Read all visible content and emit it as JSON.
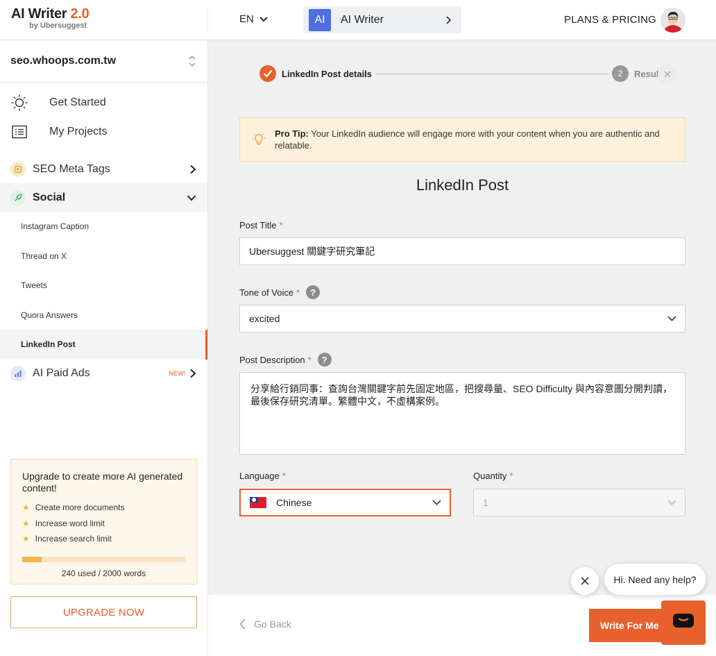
{
  "header": {
    "logo_main": "AI Writer",
    "logo_version": "2.0",
    "logo_sub": "by Ubersuggest",
    "language": "EN",
    "tool_badge": "AI",
    "tool_name": "AI Writer",
    "plans": "PLANS & PRICING"
  },
  "sidebar": {
    "site": "seo.whoops.com.tw",
    "nav": [
      {
        "label": "Get Started",
        "icon": "sun-icon"
      },
      {
        "label": "My Projects",
        "icon": "list-icon"
      }
    ],
    "groups": {
      "seo_meta": {
        "label": "SEO Meta Tags"
      },
      "social": {
        "label": "Social"
      },
      "paid_ads": {
        "label": "AI Paid Ads",
        "badge": "NEW!"
      }
    },
    "social_items": [
      "Instagram Caption",
      "Thread on X",
      "Tweets",
      "Quora Answers",
      "LinkedIn Post"
    ],
    "upgrade": {
      "title": "Upgrade to create more AI generated content!",
      "benefits": [
        "Create more documents",
        "Increase word limit",
        "Increase search limit"
      ],
      "usage_fraction": 0.12,
      "usage_text": "240 used / 2000 words",
      "button": "UPGRADE NOW"
    }
  },
  "stepper": {
    "step1": "LinkedIn Post details",
    "step2_num": "2",
    "step2": "Results"
  },
  "tip": {
    "label": "Pro Tip:",
    "text": " Your LinkedIn audience will engage more with your content when you are authentic and relatable."
  },
  "form": {
    "title": "LinkedIn Post",
    "post_title_label": "Post Title",
    "post_title_value": "Ubersuggest 關鍵字研究筆記",
    "tone_label": "Tone of Voice",
    "tone_value": "excited",
    "desc_label": "Post Description",
    "desc_value": "分享給行銷同事：查詢台灣關鍵字前先固定地區，把搜尋量、SEO Difficulty 與內容意圖分開判讀，最後保存研究清單。繁體中文，不虛構案例。",
    "language_label": "Language",
    "language_value": "Chinese",
    "quantity_label": "Quantity",
    "quantity_value": "1",
    "required_mark": "*",
    "help_mark": "?"
  },
  "footer": {
    "go_back": "Go Back",
    "write": "Write For Me"
  },
  "chat": {
    "bubble": "Hi. Need any help?"
  },
  "colors": {
    "accent": "#e8602c",
    "tool_badge": "#4e6fe0"
  }
}
